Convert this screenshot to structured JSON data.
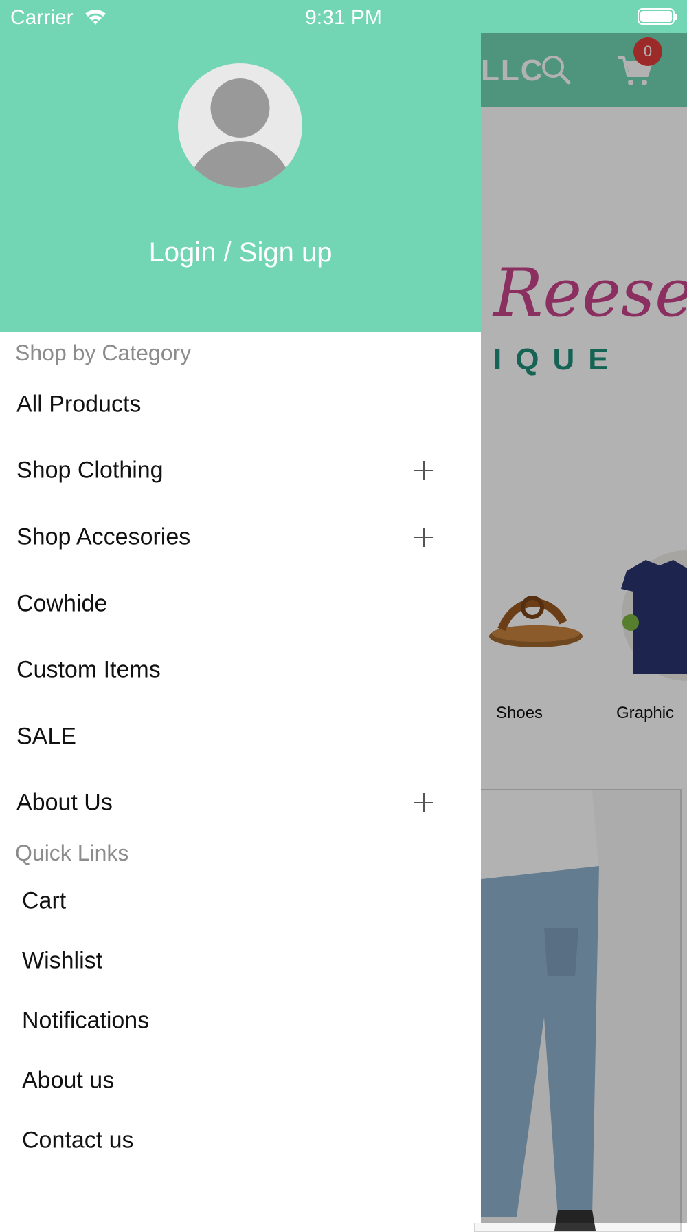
{
  "status_bar": {
    "carrier": "Carrier",
    "time": "9:31 PM"
  },
  "app": {
    "header_title_partial": "LLC",
    "cart_count": "0",
    "logo_text": "Reese",
    "logo_subtext": "IQUE",
    "categories": [
      {
        "label": "Shoes",
        "icon": "sandal-image"
      },
      {
        "label": "Graphic",
        "icon": "tshirt-image"
      }
    ]
  },
  "drawer": {
    "login_label": "Login / Sign up",
    "shop_section_title": "Shop by Category",
    "shop_items": [
      {
        "label": "All Products",
        "expandable": false
      },
      {
        "label": "Shop Clothing",
        "expandable": true
      },
      {
        "label": "Shop Accesories",
        "expandable": true
      },
      {
        "label": "Cowhide",
        "expandable": false
      },
      {
        "label": "Custom Items",
        "expandable": false
      },
      {
        "label": "SALE",
        "expandable": false
      },
      {
        "label": "About Us",
        "expandable": true
      }
    ],
    "quick_links_title": "Quick Links",
    "quick_links": [
      {
        "label": "Cart"
      },
      {
        "label": "Wishlist"
      },
      {
        "label": "Notifications"
      },
      {
        "label": "About us"
      },
      {
        "label": "Contact us"
      }
    ]
  },
  "colors": {
    "accent": "#72d6b4",
    "badge": "#e03d3a",
    "logo_pink": "#c7448a",
    "logo_teal": "#1e8e7a"
  }
}
